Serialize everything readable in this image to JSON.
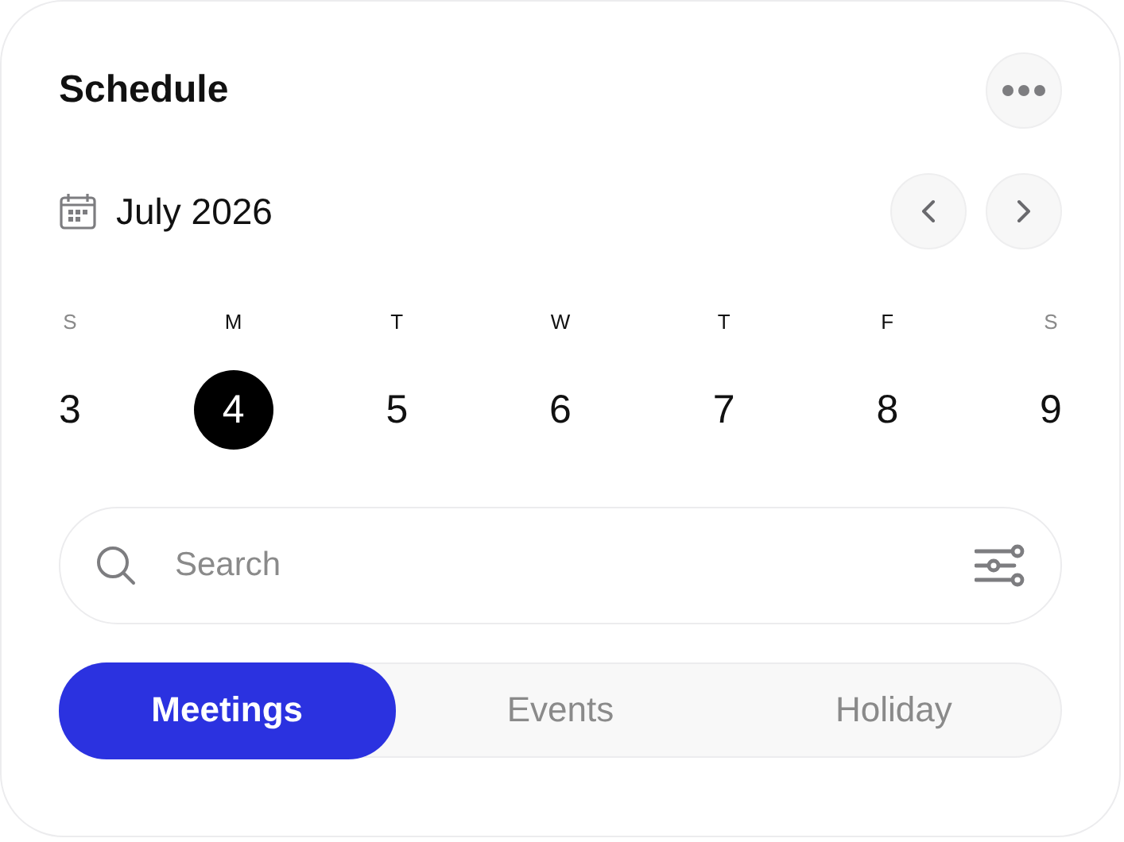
{
  "title": "Schedule",
  "month": "July 2026",
  "days": [
    {
      "letter": "S",
      "number": "3",
      "weekend": true,
      "selected": false
    },
    {
      "letter": "M",
      "number": "4",
      "weekend": false,
      "selected": true
    },
    {
      "letter": "T",
      "number": "5",
      "weekend": false,
      "selected": false
    },
    {
      "letter": "W",
      "number": "6",
      "weekend": false,
      "selected": false
    },
    {
      "letter": "T",
      "number": "7",
      "weekend": false,
      "selected": false
    },
    {
      "letter": "F",
      "number": "8",
      "weekend": false,
      "selected": false
    },
    {
      "letter": "S",
      "number": "9",
      "weekend": true,
      "selected": false
    }
  ],
  "search": {
    "placeholder": "Search"
  },
  "tabs": [
    {
      "label": "Meetings",
      "selected": true
    },
    {
      "label": "Events",
      "selected": false
    },
    {
      "label": "Holiday",
      "selected": false
    }
  ]
}
